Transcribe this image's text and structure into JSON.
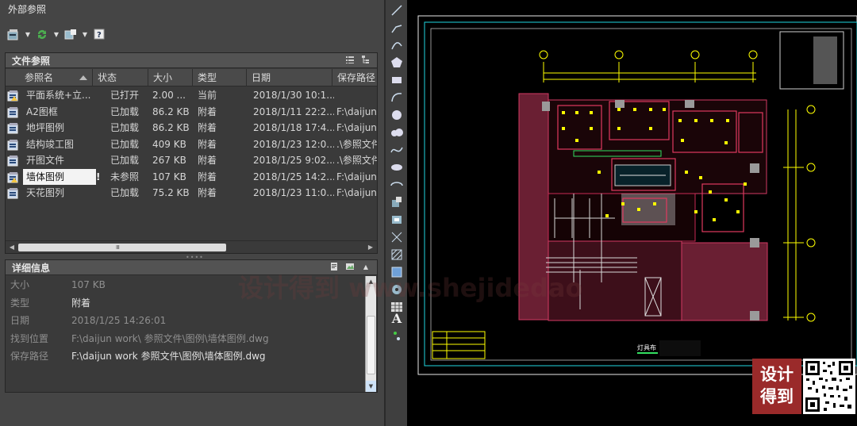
{
  "palette": {
    "title": "外部参照",
    "toolbar": [
      "attach-dwg-icon",
      "refresh-icon",
      "change-path-icon",
      "help-icon"
    ]
  },
  "refs": {
    "section_title": "文件参照",
    "columns": [
      "参照名",
      "状态",
      "大小",
      "类型",
      "日期",
      "保存路径"
    ],
    "rows": [
      {
        "name": "平面系统+立...",
        "status": "已打开",
        "size": "2.00 ...",
        "type": "当前",
        "date": "2018/1/30 10:1...",
        "path": "",
        "icon": "dwg-current-icon"
      },
      {
        "name": "A2图框",
        "status": "已加载",
        "size": "86.2 KB",
        "type": "附着",
        "date": "2018/1/11 22:2...",
        "path": "F:\\daijun",
        "icon": "dwg-file-icon"
      },
      {
        "name": "地坪图例",
        "status": "已加载",
        "size": "86.2 KB",
        "type": "附着",
        "date": "2018/1/18 17:4...",
        "path": "F:\\daijun",
        "icon": "dwg-file-icon"
      },
      {
        "name": "结构竣工图",
        "status": "已加载",
        "size": "409 KB",
        "type": "附着",
        "date": "2018/1/23 12:0...",
        "path": ".\\参照文件",
        "icon": "dwg-file-icon"
      },
      {
        "name": "开图文件",
        "status": "已加载",
        "size": "267 KB",
        "type": "附着",
        "date": "2018/1/25 9:02...",
        "path": ".\\参照文件",
        "icon": "dwg-file-icon"
      },
      {
        "name": "墙体图例",
        "status": "未参照",
        "size": "107 KB",
        "type": "附着",
        "date": "2018/1/25 14:2...",
        "path": "F:\\daijun",
        "icon": "dwg-unreferenced-icon",
        "selected": true,
        "warn": "!"
      },
      {
        "name": "天花图列",
        "status": "已加载",
        "size": "75.2 KB",
        "type": "附着",
        "date": "2018/1/23 11:0...",
        "path": "F:\\daijun",
        "icon": "dwg-file-icon"
      }
    ],
    "scroll_grip": "Ⅲ"
  },
  "details": {
    "section_title": "详细信息",
    "fields": [
      {
        "label": "大小",
        "value": "107 KB",
        "style": "muted"
      },
      {
        "label": "类型",
        "value": "附着",
        "style": "strong"
      },
      {
        "label": "日期",
        "value": "2018/1/25 14:26:01",
        "style": "muted"
      },
      {
        "label": "找到位置",
        "value": "F:\\daijun work\\  参照文件\\图例\\墙体图例.dwg",
        "style": "muted"
      },
      {
        "label": "保存路径",
        "value": "F:\\daijun work  参照文件\\图例\\墙体图例.dwg",
        "style": "strong"
      }
    ]
  },
  "tools": [
    "line-icon",
    "polyline-icon",
    "arc-icon",
    "polygon-icon",
    "rectangle-icon",
    "arc-tool-icon",
    "circle-icon",
    "cloud-icon",
    "spline-icon",
    "ellipse-icon",
    "ellipse-arc-icon",
    "insert-block-icon",
    "make-block-icon",
    "point-icon",
    "hatch-icon",
    "gradient-icon",
    "region-icon",
    "table-icon",
    "multiline-text-icon",
    "add-selected-icon"
  ],
  "tool_text_label": "A",
  "drawing": {
    "title_block_label": "灯具布"
  },
  "watermark": "设计得到 www.shejidedao",
  "brand": {
    "line1": "设计",
    "line2": "得到"
  },
  "colors": {
    "panel": "#454545",
    "list_bg": "#3a3a3a",
    "selected_row": "#f3f3f3",
    "cad_red": "#c02040",
    "cad_yellow": "#ffff00",
    "brand": "#9a2a2a"
  }
}
